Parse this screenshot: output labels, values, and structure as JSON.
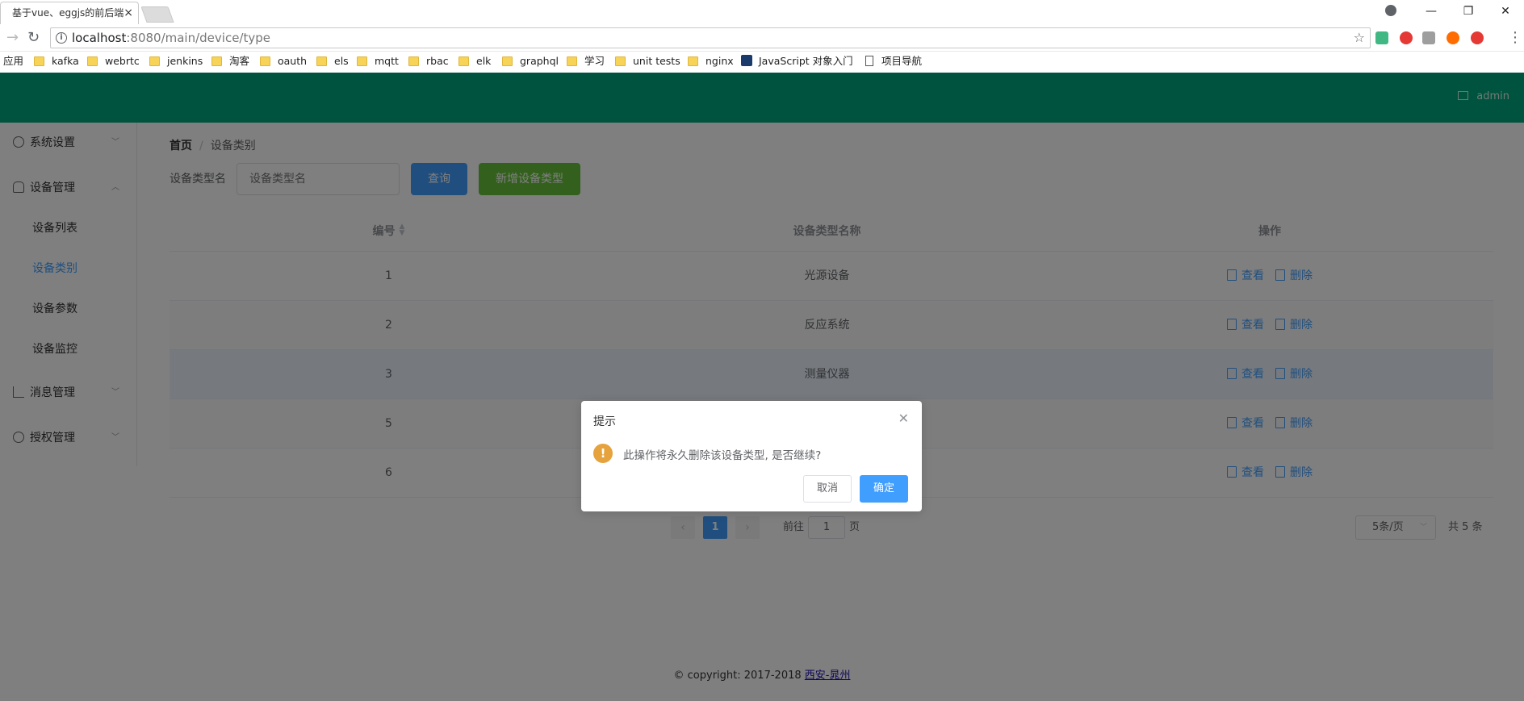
{
  "browser": {
    "tab_title": "基于vue、eggjs的前后端",
    "tab_close": "×",
    "window_controls": {
      "minimize": "—",
      "restore": "❐",
      "close": "✕"
    },
    "url_host": "localhost",
    "url_path": ":8080/main/device/type",
    "bookmarks": [
      "应用",
      "kafka",
      "webrtc",
      "jenkins",
      "淘客",
      "oauth",
      "els",
      "mqtt",
      "rbac",
      "elk",
      "graphql",
      "学习",
      "unit tests",
      "nginx",
      "JavaScript 对象入门",
      "项目导航"
    ]
  },
  "header": {
    "user": "admin"
  },
  "sidebar": {
    "menus": [
      {
        "label": "系统设置",
        "icon": "gear-icon"
      },
      {
        "label": "设备管理",
        "icon": "device-icon"
      },
      {
        "label": "消息管理",
        "icon": "chart-icon"
      },
      {
        "label": "授权管理",
        "icon": "globe-icon"
      }
    ],
    "sub_items": [
      {
        "label": "设备列表"
      },
      {
        "label": "设备类别",
        "active": true
      },
      {
        "label": "设备参数"
      },
      {
        "label": "设备监控"
      }
    ]
  },
  "breadcrumb": {
    "home": "首页",
    "separator": "/",
    "current": "设备类别"
  },
  "filter": {
    "label": "设备类型名",
    "placeholder": "设备类型名",
    "query_button": "查询",
    "add_button": "新增设备类型"
  },
  "table": {
    "columns": [
      "编号",
      "设备类型名称",
      "操作"
    ],
    "rows": [
      {
        "id": "1",
        "name": "光源设备"
      },
      {
        "id": "2",
        "name": "反应系统"
      },
      {
        "id": "3",
        "name": "测量仪器"
      },
      {
        "id": "5",
        "name": ""
      },
      {
        "id": "6",
        "name": ""
      }
    ],
    "view_label": "查看",
    "delete_label": "删除"
  },
  "pagination": {
    "current_page": "1",
    "goto_label": "前往",
    "goto_value": "1",
    "page_suffix": "页",
    "page_size": "5条/页",
    "total": "共 5 条"
  },
  "footer": {
    "text": "© copyright: 2017-2018 ",
    "link": "西安-晁州"
  },
  "dialog": {
    "title": "提示",
    "message": "此操作将永久删除该设备类型, 是否继续?",
    "cancel": "取消",
    "confirm": "确定"
  },
  "colors": {
    "header": "#00a67c",
    "primary": "#409eff",
    "success": "#67c23a",
    "warning": "#e6a23c"
  }
}
